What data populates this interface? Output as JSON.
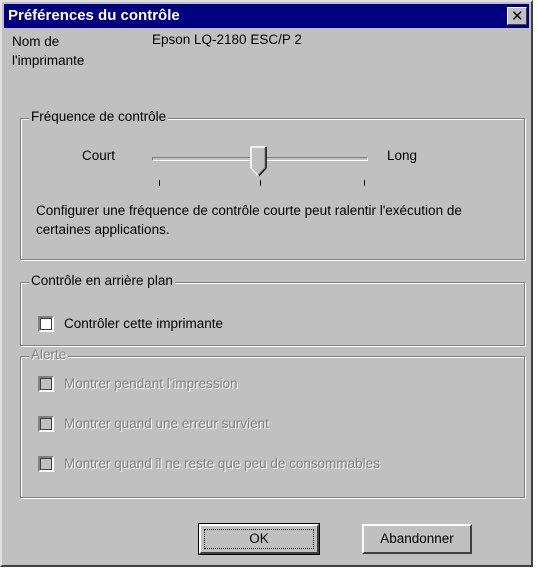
{
  "window": {
    "title": "Préférences du contrôle",
    "close_symbol": "✕"
  },
  "printer": {
    "label": "Nom de l'imprimante",
    "name": "Epson LQ-2180 ESC/P 2"
  },
  "frequency": {
    "group_label": "Fréquence de contrôle",
    "short_label": "Court",
    "long_label": "Long",
    "level": 0.5,
    "description": "Configurer une fréquence de contrôle courte peut ralentir l'exécution de certaines applications."
  },
  "background": {
    "group_label": "Contrôle en arrière plan",
    "monitor_label": "Contrôler cette imprimante",
    "monitor_checked": false
  },
  "alert": {
    "group_label": "Alerte",
    "options": [
      "Montrer pendant l'impression",
      "Montrer quand une erreur survient",
      "Montrer quand il ne reste que peu de consommables"
    ]
  },
  "buttons": {
    "ok": "OK",
    "cancel": "Abandonner"
  },
  "colors": {
    "titlebar": "#000080",
    "face": "#c0c0c0"
  }
}
